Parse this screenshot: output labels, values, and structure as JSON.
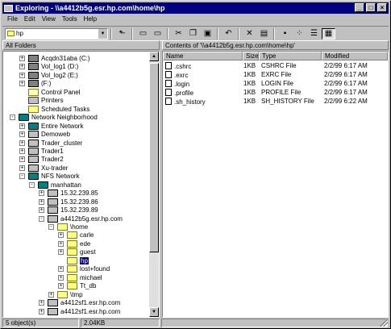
{
  "window": {
    "title": "Exploring - \\\\a4412b5g.esr.hp.com\\home\\hp",
    "controls": [
      "minimize-icon",
      "maximize-icon",
      "close-icon"
    ]
  },
  "menu": [
    "File",
    "Edit",
    "View",
    "Tools",
    "Help"
  ],
  "toolbar": {
    "address_value": "hp",
    "buttons": [
      "up-folder-icon",
      "map-drive-icon",
      "disconnect-drive-icon",
      "cut-icon",
      "copy-icon",
      "paste-icon",
      "undo-icon",
      "delete-icon",
      "properties-icon",
      "large-icons-icon",
      "small-icons-icon",
      "list-icon",
      "details-icon"
    ]
  },
  "left_header": "All Folders",
  "right_header": "Contents of '\\\\a4412b5g.esr.hp.com\\home\\hp'",
  "tree": [
    {
      "label": "Acqdn31aba (C:)",
      "expander": "+",
      "icon": "drive-icon",
      "indent": 1
    },
    {
      "label": "Vol_log1 (D:)",
      "expander": "+",
      "icon": "drive-icon",
      "indent": 1
    },
    {
      "label": "Vol_log2 (E:)",
      "expander": "+",
      "icon": "drive-icon",
      "indent": 1
    },
    {
      "label": "(F:)",
      "expander": "+",
      "icon": "cdrom-icon",
      "indent": 1
    },
    {
      "label": "Control Panel",
      "expander": "",
      "icon": "control-panel-icon",
      "indent": 1
    },
    {
      "label": "Printers",
      "expander": "",
      "icon": "printer-icon",
      "indent": 1
    },
    {
      "label": "Scheduled Tasks",
      "expander": "",
      "icon": "scheduled-tasks-icon",
      "indent": 1
    },
    {
      "label": "Network Neighborhood",
      "expander": "-",
      "icon": "network-icon",
      "indent": 0
    },
    {
      "label": "Entire Network",
      "expander": "+",
      "icon": "network-icon",
      "indent": 1
    },
    {
      "label": "Demoweb",
      "expander": "+",
      "icon": "computer-icon",
      "indent": 1
    },
    {
      "label": "Trader_cluster",
      "expander": "+",
      "icon": "computer-icon",
      "indent": 1
    },
    {
      "label": "Trader1",
      "expander": "+",
      "icon": "computer-icon",
      "indent": 1
    },
    {
      "label": "Trader2",
      "expander": "+",
      "icon": "computer-icon",
      "indent": 1
    },
    {
      "label": "Xu-trader",
      "expander": "+",
      "icon": "computer-icon",
      "indent": 1
    },
    {
      "label": "NFS Network",
      "expander": "-",
      "icon": "network-icon",
      "indent": 1
    },
    {
      "label": "manhattan",
      "expander": "-",
      "icon": "network-icon",
      "indent": 2
    },
    {
      "label": "15.32.239.85",
      "expander": "+",
      "icon": "computer-icon",
      "indent": 3
    },
    {
      "label": "15.32.239.86",
      "expander": "+",
      "icon": "computer-icon",
      "indent": 3
    },
    {
      "label": "15.32.239.89",
      "expander": "+",
      "icon": "computer-icon",
      "indent": 3
    },
    {
      "label": "a4412b5g.esr.hp.com",
      "expander": "-",
      "icon": "computer-icon",
      "indent": 3
    },
    {
      "label": "\\home",
      "expander": "-",
      "icon": "folder-icon",
      "indent": 4
    },
    {
      "label": "carle",
      "expander": "+",
      "icon": "folder-icon",
      "indent": 5
    },
    {
      "label": "ede",
      "expander": "+",
      "icon": "folder-icon",
      "indent": 5
    },
    {
      "label": "guest",
      "expander": "+",
      "icon": "folder-icon",
      "indent": 5
    },
    {
      "label": "hp",
      "expander": "",
      "icon": "folder-icon",
      "indent": 5,
      "selected": true
    },
    {
      "label": "lost+found",
      "expander": "+",
      "icon": "folder-icon",
      "indent": 5
    },
    {
      "label": "michael",
      "expander": "+",
      "icon": "folder-icon",
      "indent": 5
    },
    {
      "label": "Tt_db",
      "expander": "+",
      "icon": "folder-icon",
      "indent": 5
    },
    {
      "label": "\\tmp",
      "expander": "+",
      "icon": "folder-icon",
      "indent": 4
    },
    {
      "label": "a4412sf1.esr.hp.com",
      "expander": "+",
      "icon": "computer-icon",
      "indent": 3
    },
    {
      "label": "a4412sf1.esr.hp.com",
      "expander": "+",
      "icon": "computer-icon",
      "indent": 3
    }
  ],
  "columns": [
    "Name",
    "Size",
    "Type",
    "Modified"
  ],
  "files": [
    {
      "name": ".cshrc",
      "size": "1KB",
      "type": "CSHRC File",
      "modified": "2/2/99 6:17 AM"
    },
    {
      "name": ".exrc",
      "size": "1KB",
      "type": "EXRC File",
      "modified": "2/2/99 6:17 AM"
    },
    {
      "name": ".login",
      "size": "1KB",
      "type": "LOGIN File",
      "modified": "2/2/99 6:17 AM"
    },
    {
      "name": ".profile",
      "size": "1KB",
      "type": "PROFILE File",
      "modified": "2/2/99 6:17 AM"
    },
    {
      "name": ".sh_history",
      "size": "1KB",
      "type": "SH_HISTORY File",
      "modified": "2/2/99 6:22 AM"
    }
  ],
  "status": {
    "objects": "5 object(s)",
    "size": "2.04KB"
  }
}
